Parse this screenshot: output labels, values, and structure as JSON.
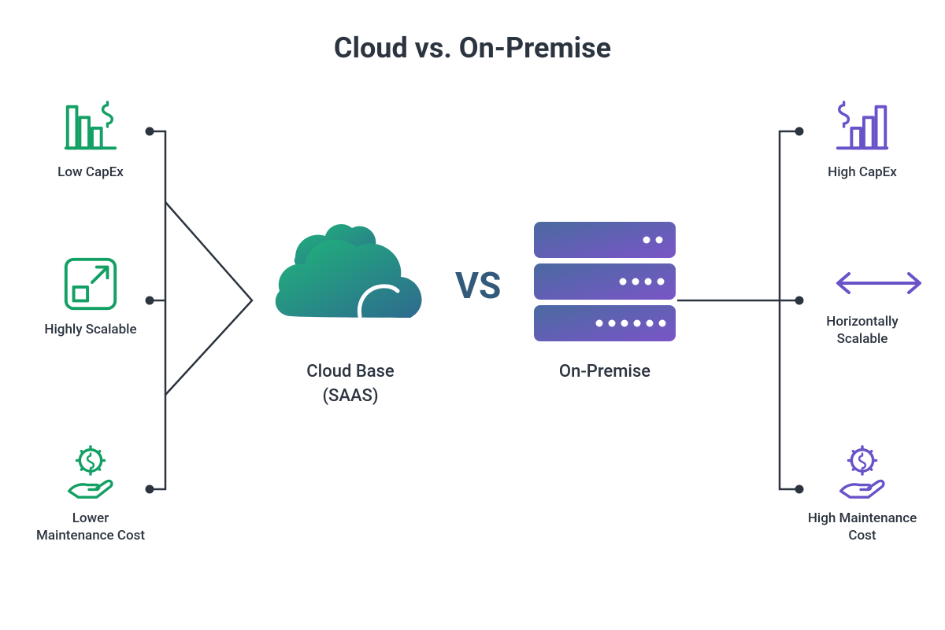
{
  "title": "Cloud vs. On-Premise",
  "left": {
    "center": {
      "label_line1": "Cloud Base",
      "label_line2": "(SAAS)"
    },
    "features": [
      {
        "label": "Low CapEx"
      },
      {
        "label": "Highly Scalable"
      },
      {
        "label": "Lower Maintenance Cost"
      }
    ]
  },
  "vs": "VS",
  "right": {
    "center": {
      "label": "On-Premise"
    },
    "features": [
      {
        "label": "High CapEx"
      },
      {
        "label": "Horizontally Scalable"
      },
      {
        "label": "High Maintenance Cost"
      }
    ]
  },
  "colors": {
    "green": "#13a064",
    "purple": "#6a52c9",
    "dark": "#2c3440",
    "vs": "#335a7a"
  }
}
